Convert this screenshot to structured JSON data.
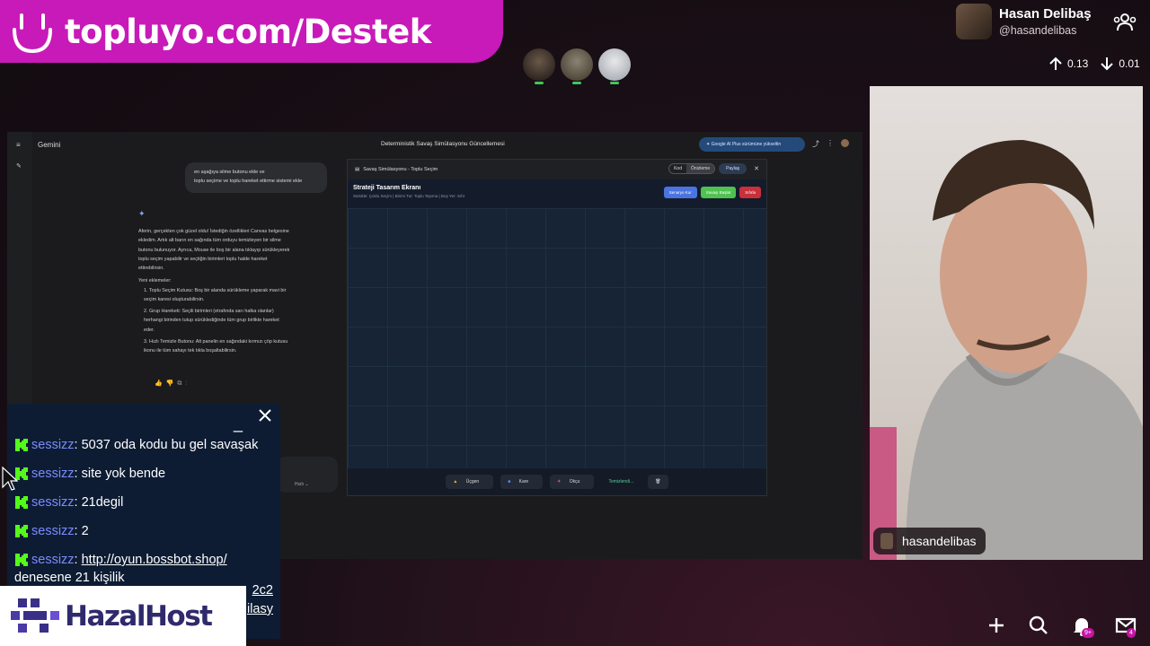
{
  "banner": {
    "text": "topluyo.com/Destek",
    "icon": "smile-icon",
    "color": "#c81ab8"
  },
  "streamer": {
    "name": "Hasan Delibaş",
    "handle": "@hasandelibas",
    "upload_rate": "0.13",
    "download_rate": "0.01"
  },
  "screen": {
    "app_name": "Gemini",
    "title": "Deterministik Savaş Simülasyonu Güncellemesi",
    "upgrade_label": "Google AI Plus sürümüne yükseltin",
    "user_bubble": [
      "en aşağıya silme butonu ekle ve",
      "toplu seçime ve toplu hareket ettirme sistemi ekle"
    ],
    "answer_intro": [
      "Aferin, gerçekten çok güzel oldu! İstediğin özellikleri Canvas belgesine",
      "ekledim. Artık alt barın en sağında tüm orduyu temizleyen bir silme",
      "butonu bulunuyor. Ayrıca, Mouse ile boş bir alana tıklayıp sürükleyerek",
      "toplu seçim yapabilir ve seçtiğin birimleri toplu halde hareket",
      "ettirebilirsin."
    ],
    "answer_list_title": "Yeni eklemeler:",
    "answer_items": [
      [
        "1. Toplu Seçim Kutusu: Boş bir alanda sürükleme yaparak mavi bir",
        "seçim karesi oluşturabilirsin."
      ],
      [
        "2. Grup Hareketi: Seçili birimleri (etrafında sarı halka olanlar)",
        "herhangi birinden tutup sürüklediğinde tüm grup birlikte hareket",
        "eder."
      ],
      [
        "3. Hızlı Temizle Butonu: Alt panelin en sağındaki kırmızı çöp kutusu",
        "ikonu ile tüm sahayı tek tıkla boşaltabilirsin."
      ]
    ],
    "input_mode": "Hızlı",
    "canvas": {
      "doc_title": "Savaş Simülasyonu - Toplu Seçim",
      "tab_code": "Kod",
      "tab_preview": "Önizleme",
      "share": "Paylaş",
      "heading": "Strateji Tasarım Ekranı",
      "subheading": "Sürükle: Çoklu Seçim | Birimi Tut: Toplu Taşıma | Boş Yer: Sıfır",
      "btn1": "Senaryo Kur",
      "btn2": "Savaşı Başlat",
      "btn3": "Sıfırla",
      "btn_a": "Üçgen",
      "btn_b": "Kare",
      "btn_c": "Okçu",
      "status": "Temizlendi..."
    }
  },
  "chat": {
    "messages": [
      {
        "user": "sessizz",
        "text": "5037 oda kodu bu gel savaşak"
      },
      {
        "user": "sessizz",
        "text": "site yok bende"
      },
      {
        "user": "sessizz",
        "text": "21degil"
      },
      {
        "user": "sessizz",
        "text": "2"
      },
      {
        "user": "sessizz",
        "link": "http://oyun.bossbot.shop/",
        "text2": "denesene 21 kişilik"
      }
    ],
    "trail1": "2c2",
    "trail2": "ilasy"
  },
  "sponsor": {
    "name": "HazalHost"
  },
  "cam": {
    "label": "hasandelibas"
  },
  "notifications": {
    "bell_badge": "9+",
    "mail_badge": "4"
  }
}
